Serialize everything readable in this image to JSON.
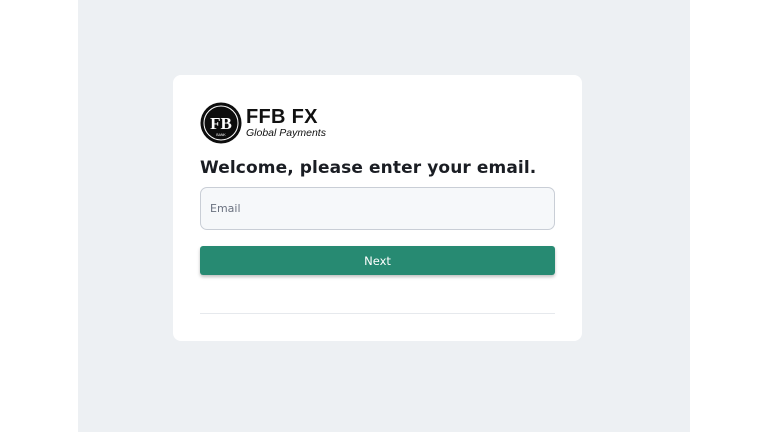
{
  "brand": {
    "name": "FFB FX",
    "tagline": "Global Payments",
    "mark_letters": "FB",
    "mark_caption": "BANK"
  },
  "login": {
    "heading": "Welcome, please enter your email.",
    "email_placeholder": "Email",
    "email_value": "",
    "next_label": "Next"
  },
  "colors": {
    "page_background": "#edf0f3",
    "card_background": "#ffffff",
    "primary_button": "#278a72",
    "heading_text": "#1a1d23"
  }
}
